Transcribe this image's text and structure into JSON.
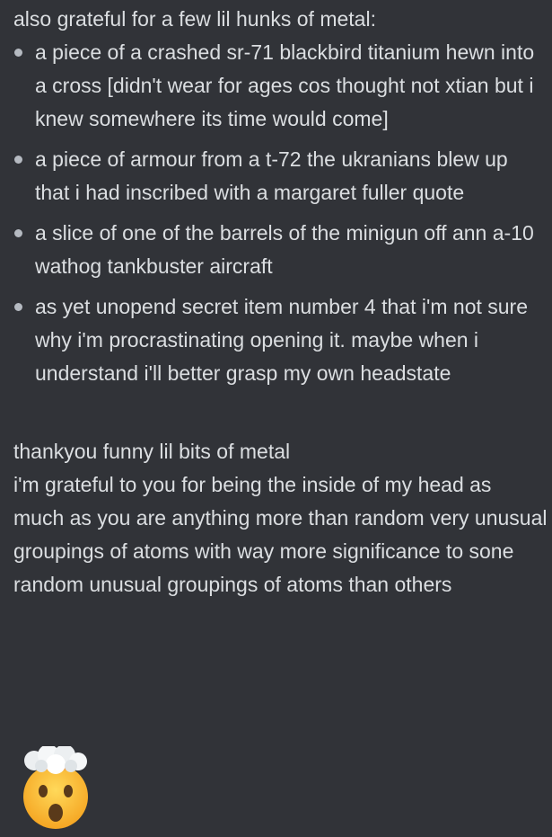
{
  "message": {
    "intro": "also grateful for a few lil hunks of metal:",
    "items": [
      "a piece of a crashed sr-71 blackbird titanium hewn into a cross [didn't wear for ages cos thought not xtian but i knew somewhere its time would come]",
      "a piece of armour from a t-72 the ukranians blew up that i had inscribed with a margaret fuller quote",
      "a slice of one of the barrels of the minigun off ann a-10 wathog tankbuster aircraft",
      "as yet unopend secret item number 4 that i'm not sure why i'm procrastinating opening it. maybe when i understand i'll better grasp my own headstate"
    ],
    "para1": "thankyou funny lil bits of metal",
    "para2": "i'm grateful to you for being the inside of my head as much as you are anything more than random very unusual groupings of atoms with way more significance to sone random unusual groupings of atoms than others",
    "emoji": "exploding-head-emoji"
  },
  "colors": {
    "background": "#313338",
    "text": "#dbdee1",
    "bullet": "#b5bac1"
  }
}
